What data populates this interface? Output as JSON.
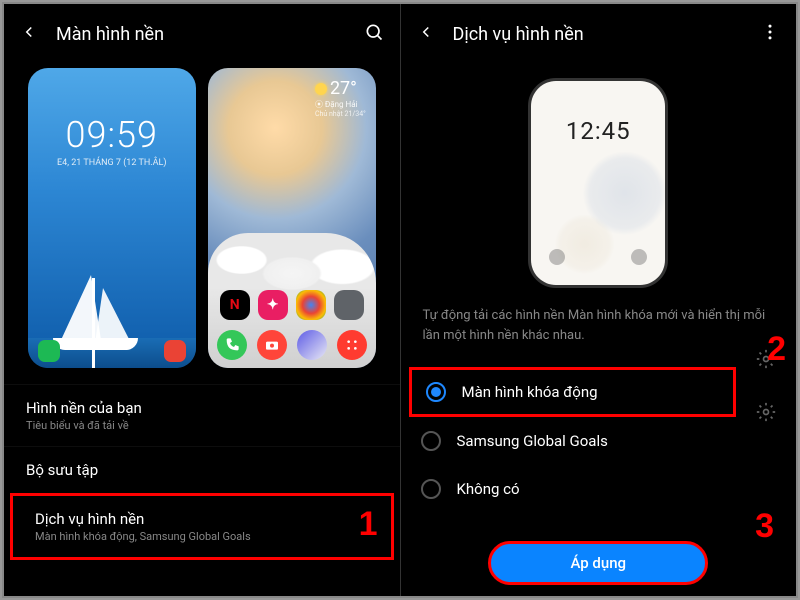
{
  "left": {
    "title": "Màn hình nền",
    "lock_time": "09:59",
    "lock_date": "E4, 21 THÁNG 7 (12 TH.ÂL)",
    "weather_temp": "27°",
    "weather_loc": "⦿ Đặng Hải",
    "weather_range": "Chủ nhật 21/34°",
    "items": [
      {
        "title": "Hình nền của bạn",
        "sub": "Tiêu biểu và đã tải về"
      },
      {
        "title": "Bộ sưu tập",
        "sub": ""
      },
      {
        "title": "Dịch vụ hình nền",
        "sub": "Màn hình khóa động, Samsung Global Goals"
      }
    ]
  },
  "right": {
    "title": "Dịch vụ hình nền",
    "mock_time": "12:45",
    "description": "Tự động tải các hình nền Màn hình khóa mới và hiển thị mỗi lần một hình nền khác nhau.",
    "options": [
      {
        "label": "Màn hình khóa động",
        "selected": true,
        "gear": true
      },
      {
        "label": "Samsung Global Goals",
        "selected": false,
        "gear": true
      },
      {
        "label": "Không có",
        "selected": false,
        "gear": false
      }
    ],
    "apply": "Áp dụng"
  },
  "callouts": {
    "one": "1",
    "two": "2",
    "three": "3"
  }
}
